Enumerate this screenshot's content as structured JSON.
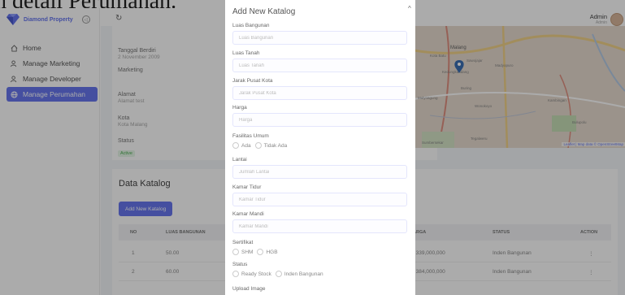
{
  "page_heading_partial": "n detail Perumahan.",
  "brand": {
    "name": "Diamond Property"
  },
  "sidebar": {
    "items": [
      {
        "label": "Home"
      },
      {
        "label": "Manage Marketing"
      },
      {
        "label": "Manage Developer"
      },
      {
        "label": "Manage Perumahan"
      }
    ]
  },
  "topbar": {
    "back_icon": "↻",
    "admin_name": "Admin",
    "admin_role": "Admin"
  },
  "detail": {
    "fields": [
      {
        "label": "Tanggal Berdiri",
        "value": "2 November 2009"
      },
      {
        "label": "Marketing",
        "value": ""
      },
      {
        "label": "Alamat",
        "value": "Alamat test"
      },
      {
        "label": "Kota",
        "value": "Kota Malang"
      }
    ],
    "status_label": "Status",
    "status_value": "Active"
  },
  "map": {
    "places": [
      "Malang",
      "Kota Batu",
      "Sawojajar",
      "Madyopuro",
      "Buring",
      "Kedungkandang",
      "Wonokoyo",
      "Kambingan",
      "Tegalweru",
      "Sumbersekar",
      "Mulyoagung",
      "Bulupolu"
    ],
    "attribution": "Leaflet | Map data © OpenStreetMap"
  },
  "catalog": {
    "title": "Data Katalog",
    "add_label": "Add New Katalog",
    "columns": [
      "NO",
      "LUAS BANGUNAN",
      "ARGA",
      "STATUS",
      "ACTION"
    ],
    "rows": [
      {
        "no": "1",
        "luas": "50.00",
        "harga": ". 339,000,000",
        "status": "Inden Bangunan",
        "action": "⋮"
      },
      {
        "no": "2",
        "luas": "60.00",
        "harga": ". 384,000,000",
        "status": "Inden Bangunan",
        "action": "⋮"
      }
    ]
  },
  "modal": {
    "title": "Add New Katalog",
    "close_label": "^",
    "fields": [
      {
        "label": "Luas Bangunan",
        "placeholder": "Luas Bangunan"
      },
      {
        "label": "Luas Tanah",
        "placeholder": "Luas Tanah"
      },
      {
        "label": "Jarak Pusat Kota",
        "placeholder": "Jarak Pusat Kota"
      },
      {
        "label": "Harga",
        "placeholder": "Harga"
      }
    ],
    "fasilitas": {
      "label": "Fasilitas Umum",
      "options": [
        "Ada",
        "Tidak Ada"
      ]
    },
    "fields2": [
      {
        "label": "Lantai",
        "placeholder": "Jumlah Lantai"
      },
      {
        "label": "Kamar Tidur",
        "placeholder": "Kamar Tidur"
      },
      {
        "label": "Kamar Mandi",
        "placeholder": "Kamar Mandi"
      }
    ],
    "sertifikat": {
      "label": "Sertifikat",
      "options": [
        "SHM",
        "HGB"
      ]
    },
    "status": {
      "label": "Status",
      "options": [
        "Ready Stock",
        "Inden Bangunan"
      ]
    },
    "upload_label": "Upload Image"
  },
  "colors": {
    "primary": "#6777ef",
    "success": "#4caf50",
    "backdrop": "rgba(0,0,0,0.33)"
  }
}
